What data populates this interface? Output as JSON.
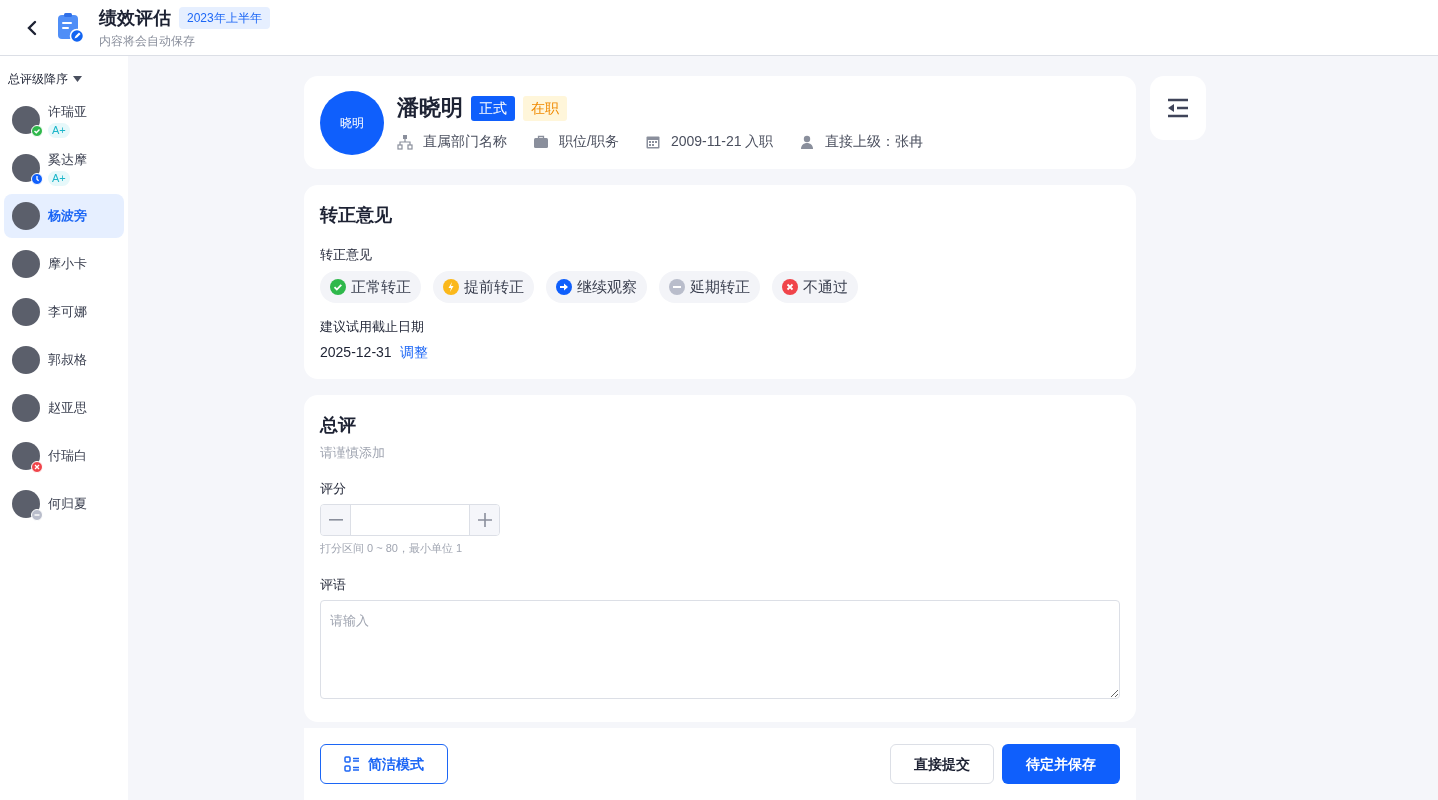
{
  "header": {
    "title": "绩效评估",
    "period_badge": "2023年上半年",
    "subtitle": "内容将会自动保存"
  },
  "sidebar": {
    "sort_label": "总评级降序",
    "people": [
      {
        "name": "许瑞亚",
        "grade": "A+",
        "kind": "done",
        "selected": false
      },
      {
        "name": "奚达摩",
        "grade": "A+",
        "kind": "pending",
        "selected": false
      },
      {
        "name": "杨波旁",
        "kind": "plain",
        "selected": true
      },
      {
        "name": "摩小卡",
        "kind": "plain",
        "selected": false
      },
      {
        "name": "李可娜",
        "kind": "plain",
        "selected": false
      },
      {
        "name": "郭叔格",
        "kind": "plain",
        "selected": false
      },
      {
        "name": "赵亚思",
        "kind": "plain",
        "selected": false
      },
      {
        "name": "付瑞白",
        "kind": "rejected",
        "selected": false
      },
      {
        "name": "何归夏",
        "kind": "delayed",
        "selected": false
      }
    ]
  },
  "profile": {
    "avatar_text": "晓明",
    "name": "潘晓明",
    "tags": [
      {
        "label": "正式",
        "kind": "type"
      },
      {
        "label": "在职",
        "kind": "state"
      }
    ],
    "meta": [
      {
        "kind": "department",
        "text": "直属部门名称"
      },
      {
        "kind": "position",
        "text": "职位/职务"
      },
      {
        "kind": "date",
        "text": "2009-11-21 入职"
      },
      {
        "kind": "manager",
        "text": "直接上级：张冉"
      }
    ]
  },
  "confirmation": {
    "title": "转正意见",
    "field_label": "转正意见",
    "options": [
      {
        "label": "正常转正",
        "kind": "ok"
      },
      {
        "label": "提前转正",
        "kind": "fast"
      },
      {
        "label": "继续观察",
        "kind": "next"
      },
      {
        "label": "延期转正",
        "kind": "delay"
      },
      {
        "label": "不通过",
        "kind": "fail"
      }
    ],
    "date_label": "建议试用截止日期",
    "date_value": "2025-12-31",
    "adjust_link": "调整"
  },
  "review": {
    "title": "总评",
    "hint": "请谨慎添加",
    "score_label": "评分",
    "score_help": "打分区间 0 ~ 80，最小单位 1",
    "comment_label": "评语",
    "comment_placeholder": "请输入"
  },
  "footer": {
    "mode_button": "简洁模式",
    "submit_button": "直接提交",
    "save_button": "待定并保存"
  }
}
